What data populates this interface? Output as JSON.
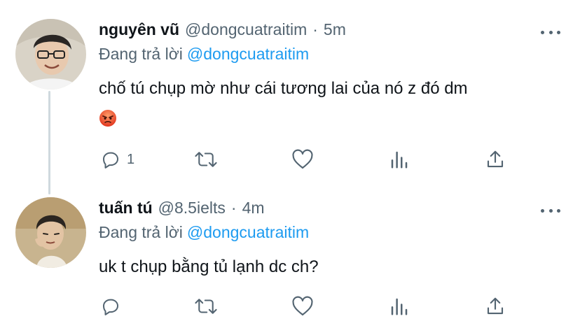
{
  "tweets": [
    {
      "name": "nguyên vũ",
      "handle": "@dongcuatraitim",
      "dot": "·",
      "time": "5m",
      "reply_label": "Đang trả lời",
      "reply_handle": "@dongcuatraitim",
      "text": "chố tú chụp mờ như cái tương lai của nó z đó dm",
      "emoji": "angry-face",
      "reply_count": "1"
    },
    {
      "name": "tuấn tú",
      "handle": "@8.5ielts",
      "dot": "·",
      "time": "4m",
      "reply_label": "Đang trả lời",
      "reply_handle": "@dongcuatraitim",
      "text": "uk t chụp bằng tủ lạnh dc ch?",
      "reply_count": ""
    }
  ],
  "colors": {
    "text": "#0f1419",
    "secondary": "#536471",
    "link": "#1d9bf0",
    "thread_line": "#cfd9de"
  }
}
